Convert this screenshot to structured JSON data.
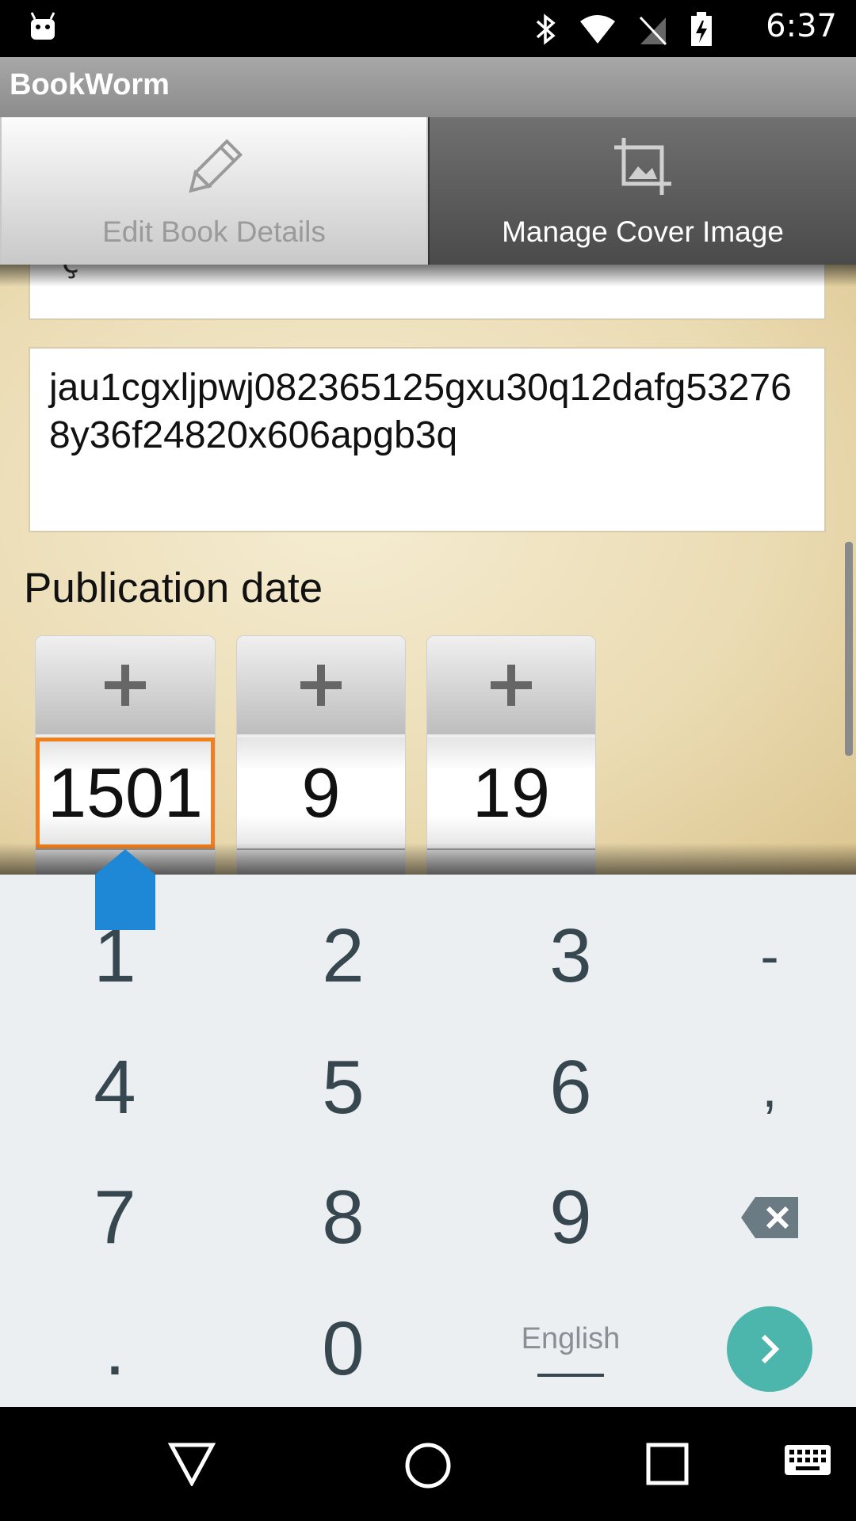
{
  "status_bar": {
    "time": "6:37",
    "icons": [
      "android-icon",
      "bluetooth-icon",
      "wifi-icon",
      "no-sim-icon",
      "battery-charging-icon"
    ]
  },
  "app_bar": {
    "title": "BookWorm"
  },
  "tabs": [
    {
      "label": "Edit Book Details",
      "icon": "pencil-icon",
      "selected": true
    },
    {
      "label": "Manage Cover Image",
      "icon": "crop-image-icon",
      "selected": false
    }
  ],
  "form": {
    "partial_field_char": "ç",
    "text_field_value": "jau1cgxljpwj082365125gxu30q12dafg532768y36f24820x606apgb3q",
    "publication_date_label": "Publication date",
    "date_picker": {
      "year": "1501",
      "month": "9",
      "day": "19",
      "increment_symbol": "+"
    }
  },
  "keyboard": {
    "rows": [
      [
        "1",
        "2",
        "3",
        "-"
      ],
      [
        "4",
        "5",
        "6",
        ","
      ],
      [
        "7",
        "8",
        "9",
        "⌫"
      ],
      [
        ".",
        "0",
        "English",
        "›"
      ]
    ],
    "language": "English",
    "accent_color": "#4db6ac"
  },
  "colors": {
    "focus_border": "#f07f1c",
    "cursor_handle": "#1e88d6"
  },
  "nav_bar": {
    "buttons": [
      "back-icon",
      "home-icon",
      "recents-icon",
      "keyboard-icon"
    ]
  }
}
